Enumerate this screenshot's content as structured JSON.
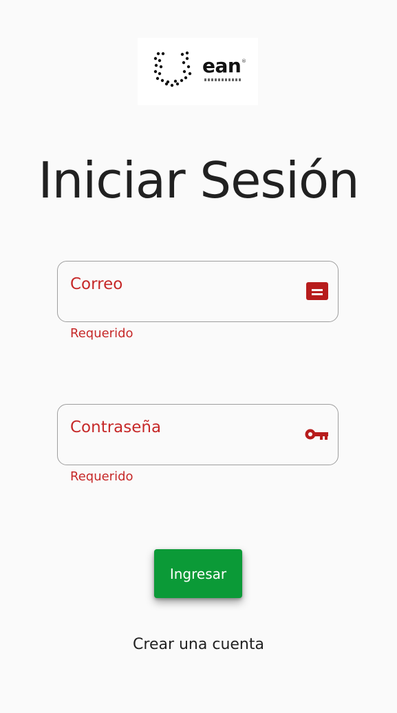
{
  "logo": {
    "text": "ean",
    "reg_mark": "®"
  },
  "title": "Iniciar Sesión",
  "email": {
    "label": "Correo",
    "error": "Requerido",
    "icon": "contact-card-icon"
  },
  "password": {
    "label": "Contraseña",
    "error": "Requerido",
    "icon": "key-icon"
  },
  "submit_label": "Ingresar",
  "create_account_label": "Crear una cuenta",
  "colors": {
    "error": "#c62828",
    "primary": "#0b9a37",
    "icon": "#b71c1c"
  }
}
